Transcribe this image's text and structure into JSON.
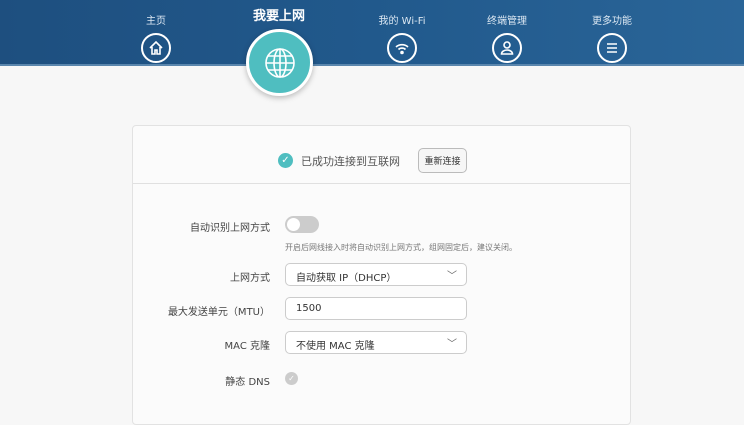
{
  "nav": {
    "items": [
      {
        "label": "主页",
        "icon": "home-icon"
      },
      {
        "label": "我要上网",
        "icon": "globe-icon",
        "active": true
      },
      {
        "label": "我的 Wi-Fi",
        "icon": "wifi-icon"
      },
      {
        "label": "终端管理",
        "icon": "user-icon"
      },
      {
        "label": "更多功能",
        "icon": "menu-icon"
      }
    ]
  },
  "status": {
    "text": "已成功连接到互联网",
    "reconnect_label": "重新连接"
  },
  "form": {
    "auto_detect_label": "自动识别上网方式",
    "auto_detect_on": false,
    "auto_detect_hint": "开启后网线接入时将自动识别上网方式，组网固定后，建议关闭。",
    "mode_label": "上网方式",
    "mode_value": "自动获取 IP（DHCP）",
    "mtu_label": "最大发送单元（MTU）",
    "mtu_value": "1500",
    "mac_label": "MAC 克隆",
    "mac_value": "不使用 MAC 克隆",
    "dns_label": "静态 DNS"
  },
  "colors": {
    "accent": "#4fbec0",
    "header": "#21598c"
  }
}
